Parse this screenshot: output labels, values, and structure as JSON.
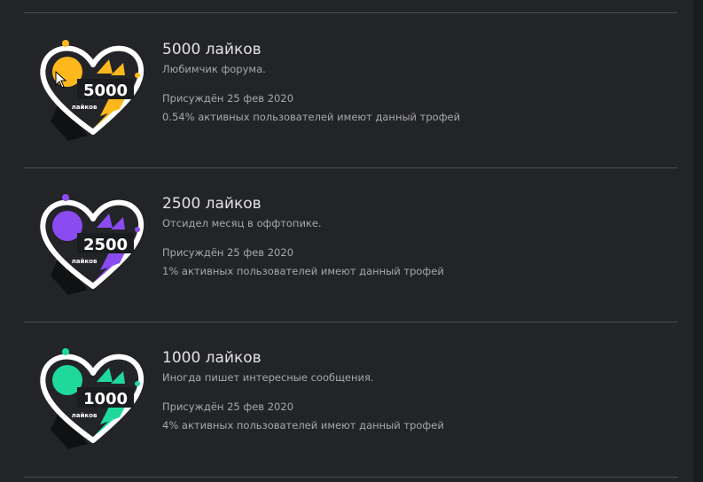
{
  "trophies": [
    {
      "title": "5000 лайков",
      "description": "Любимчик форума.",
      "awarded": "Присуждён 25 фев 2020",
      "stat": "0.54% активных пользователей имеют данный трофей",
      "badge": {
        "number": "5000",
        "caption": "лайков",
        "color": "#ffb81c",
        "icon": "heart-trophy-icon"
      }
    },
    {
      "title": "2500 лайков",
      "description": "Отсидел месяц в оффтопике.",
      "awarded": "Присуждён 25 фев 2020",
      "stat": "1% активных пользователей имеют данный трофей",
      "badge": {
        "number": "2500",
        "caption": "лайков",
        "color": "#8a4cf0",
        "icon": "heart-trophy-icon"
      }
    },
    {
      "title": "1000 лайков",
      "description": "Иногда пишет интересные сообщения.",
      "awarded": "Присуждён 25 фев 2020",
      "stat": "4% активных пользователей имеют данный трофей",
      "badge": {
        "number": "1000",
        "caption": "лайков",
        "color": "#1fd99b",
        "icon": "heart-trophy-icon"
      }
    }
  ]
}
